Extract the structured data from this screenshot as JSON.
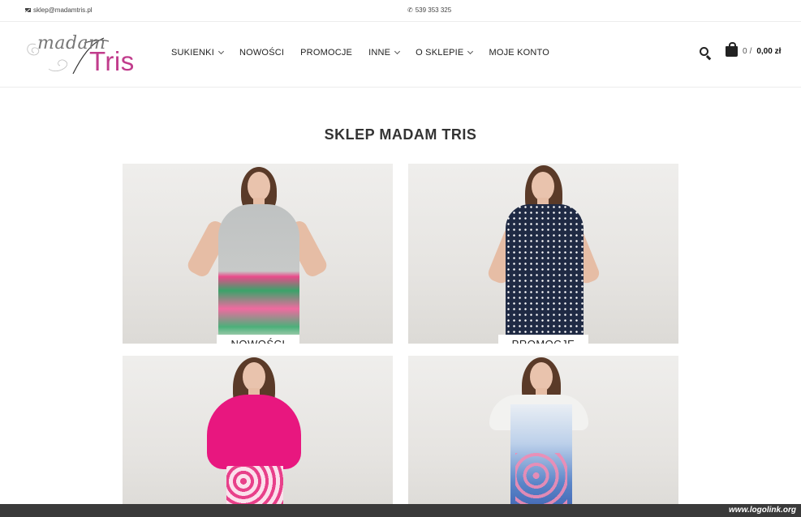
{
  "topbar": {
    "email": "sklep@madamtris.pl",
    "phone": "539 353 325"
  },
  "logo": {
    "word1": "madam",
    "word2": "Tris"
  },
  "nav": [
    {
      "label": "SUKIENKI",
      "dropdown": true
    },
    {
      "label": "NOWOŚCI",
      "dropdown": false
    },
    {
      "label": "PROMOCJE",
      "dropdown": false
    },
    {
      "label": "INNE",
      "dropdown": true
    },
    {
      "label": "O SKLEPIE",
      "dropdown": true
    },
    {
      "label": "MOJE KONTO",
      "dropdown": false
    }
  ],
  "cart": {
    "count": "0",
    "separator": "/",
    "total": "0,00 zł"
  },
  "page_title": "SKLEP MADAM TRIS",
  "tiles": [
    {
      "label": "NOWOŚCI",
      "dress": "grey-floral"
    },
    {
      "label": "PROMOCJE",
      "dress": "navy-dots"
    },
    {
      "label": "",
      "dress": "pink-floral"
    },
    {
      "label": "",
      "dress": "blue-tulip"
    }
  ],
  "watermark": "www.logolink.org",
  "colors": {
    "brand_pink": "#c13c8c",
    "text": "#222222",
    "border": "#ececec"
  }
}
